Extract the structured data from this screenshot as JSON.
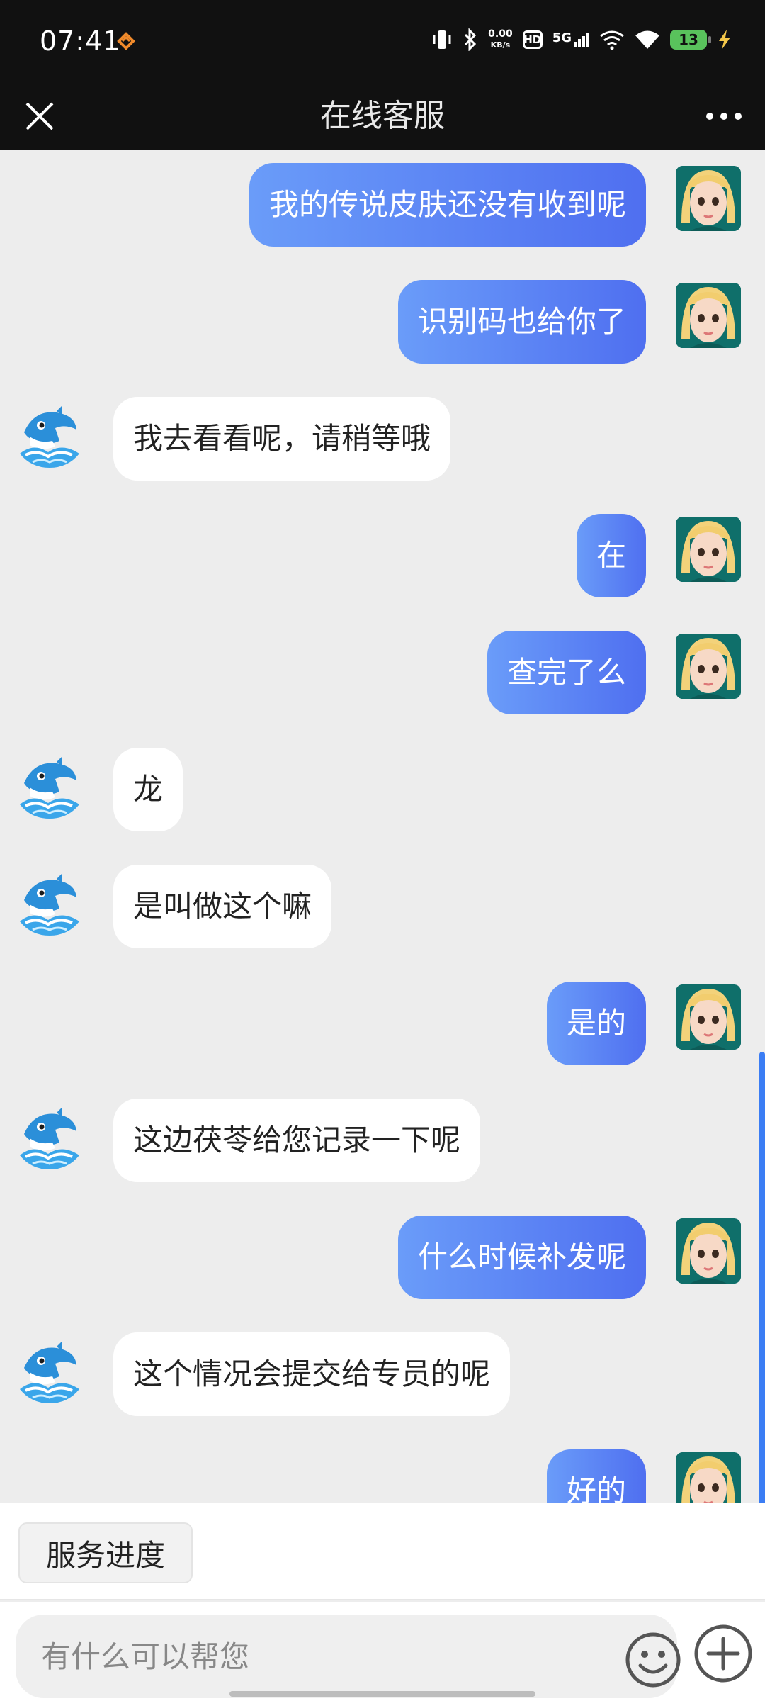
{
  "status_bar": {
    "time": "07:41",
    "net_speed_value": "0.00",
    "net_speed_unit": "KB/s",
    "hd_label": "HD",
    "network_label": "5G",
    "battery_level": "13",
    "icons": [
      "app-notification-icon",
      "vibrate-icon",
      "bluetooth-icon",
      "signal-icon",
      "wifi-call-icon",
      "wifi-icon",
      "battery-icon",
      "charging-icon"
    ]
  },
  "header": {
    "title": "在线客服",
    "close_icon": "close-icon",
    "more_icon": "more-icon"
  },
  "messages": [
    {
      "side": "right",
      "text": "我的传说皮肤还没有收到呢"
    },
    {
      "side": "right",
      "text": "识别码也给你了"
    },
    {
      "side": "left",
      "text": "我去看看呢，请稍等哦"
    },
    {
      "side": "right",
      "text": "在"
    },
    {
      "side": "right",
      "text": "查完了么"
    },
    {
      "side": "left",
      "text": "龙"
    },
    {
      "side": "left",
      "text": "是叫做这个嘛"
    },
    {
      "side": "right",
      "text": "是的"
    },
    {
      "side": "left",
      "text": "这边茯苓给您记录一下呢"
    },
    {
      "side": "right",
      "text": "什么时候补发呢"
    },
    {
      "side": "left",
      "text": "这个情况会提交给专员的呢"
    },
    {
      "side": "right",
      "text": "好的"
    }
  ],
  "quick_actions": {
    "service_progress": "服务进度"
  },
  "input": {
    "placeholder": "有什么可以帮您",
    "emoji_icon": "emoji-icon",
    "plus_icon": "plus-icon"
  },
  "colors": {
    "user_bubble_start": "#6a9cf9",
    "user_bubble_end": "#4f6ff0",
    "bot_bubble": "#ffffff",
    "chat_background": "#ededed",
    "header_background": "#111111"
  }
}
